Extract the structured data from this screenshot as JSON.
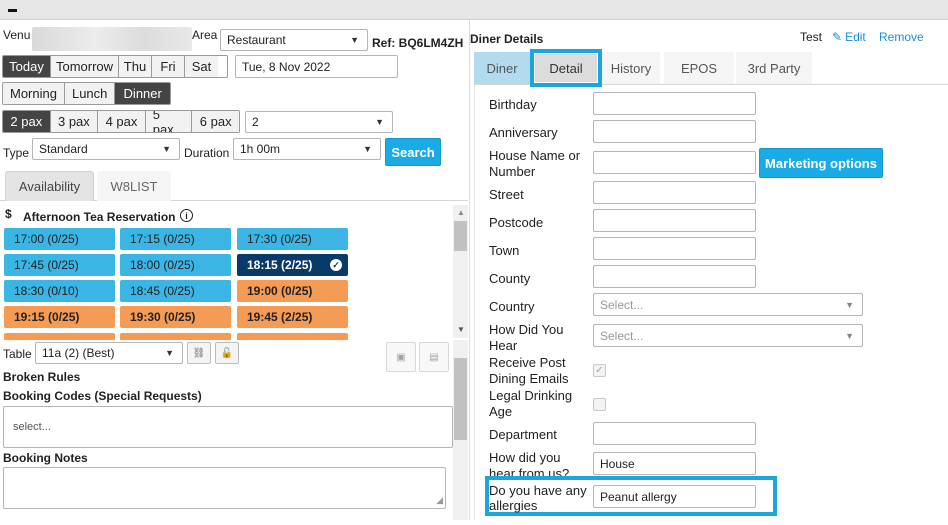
{
  "left": {
    "venue_label": "Venu",
    "area_label": "Area",
    "area_value": "Restaurant",
    "ref": "Ref: BQ6LM4ZH",
    "days": [
      "Today",
      "Tomorrow",
      "Thu",
      "Fri",
      "Sat"
    ],
    "date_value": "Tue, 8 Nov 2022",
    "meals": [
      "Morning",
      "Lunch",
      "Dinner"
    ],
    "pax": [
      "2 pax",
      "3 pax",
      "4 pax",
      "5 pax",
      "6 pax"
    ],
    "pax_select": "2",
    "type_label": "Type",
    "type_value": "Standard",
    "duration_label": "Duration",
    "duration_value": "1h 00m",
    "search_label": "Search",
    "tabs": [
      "Availability",
      "W8LIST"
    ],
    "dollar": "$",
    "section_title": "Afternoon Tea Reservation",
    "slots": [
      {
        "label": "17:00 (0/25)",
        "style": "blue"
      },
      {
        "label": "17:15 (0/25)",
        "style": "blue"
      },
      {
        "label": "17:30 (0/25)",
        "style": "blue"
      },
      {
        "label": "17:45 (0/25)",
        "style": "blue"
      },
      {
        "label": "18:00 (0/25)",
        "style": "blue"
      },
      {
        "label": "18:15 (2/25)",
        "style": "dark"
      },
      {
        "label": "18:30 (0/10)",
        "style": "blue"
      },
      {
        "label": "18:45 (0/25)",
        "style": "blue"
      },
      {
        "label": "19:00 (0/25)",
        "style": "orange"
      },
      {
        "label": "19:15 (0/25)",
        "style": "orange"
      },
      {
        "label": "19:30 (0/25)",
        "style": "orange"
      },
      {
        "label": "19:45 (2/25)",
        "style": "orange"
      }
    ],
    "table_label": "Table",
    "table_value": "11a (2) (Best)",
    "broken_rules": "Broken Rules",
    "booking_codes": "Booking Codes (Special Requests)",
    "codes_placeholder": "select...",
    "booking_notes": "Booking Notes"
  },
  "right": {
    "title": "Diner Details",
    "test_label": "Test",
    "edit_label": "Edit",
    "remove_label": "Remove",
    "tabs": [
      "Diner",
      "Detail",
      "History",
      "EPOS",
      "3rd Party"
    ],
    "fields": {
      "birthday": "Birthday",
      "anniversary": "Anniversary",
      "house_name": "House Name or Number",
      "street": "Street",
      "postcode": "Postcode",
      "town": "Town",
      "county": "County",
      "country": "Country",
      "how_did_you_hear": "How Did You Hear",
      "receive_post": "Receive Post Dining Emails",
      "legal_age": "Legal Drinking Age",
      "department": "Department",
      "how_did_you_hear_2": "How did you hear from us?",
      "allergies": "Do you have any allergies"
    },
    "select_placeholder": "Select...",
    "marketing_label": "Marketing options",
    "hear_value": "House",
    "allergies_value": "Peanut allergy"
  },
  "colors": {
    "accent": "#1aabe6",
    "highlight": "#1da6dd",
    "slot_blue": "#3ab5e4",
    "slot_dark": "#0a3a6a",
    "slot_orange": "#f49b55"
  }
}
